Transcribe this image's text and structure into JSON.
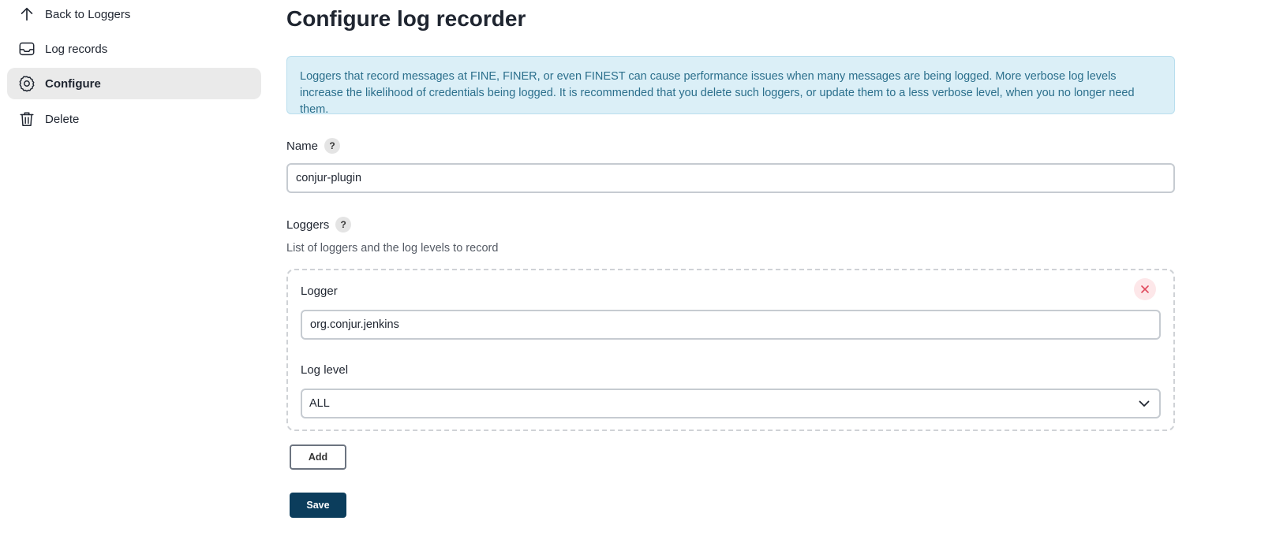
{
  "sidebar": {
    "items": [
      {
        "label": "Back to Loggers",
        "icon": "arrow-up-icon"
      },
      {
        "label": "Log records",
        "icon": "inbox-icon"
      },
      {
        "label": "Configure",
        "icon": "gear-icon",
        "active": true
      },
      {
        "label": "Delete",
        "icon": "trash-icon"
      }
    ]
  },
  "main": {
    "title": "Configure log recorder",
    "alert": "Loggers that record messages at FINE, FINER, or even FINEST can cause performance issues when many messages are being logged. More verbose log levels increase the likelihood of credentials being logged. It is recommended that you delete such loggers, or update them to a less verbose level, when you no longer need them.",
    "name_label": "Name",
    "help_glyph": "?",
    "name_value": "conjur-plugin",
    "loggers_label": "Loggers",
    "loggers_description": "List of loggers and the log levels to record",
    "logger_entry": {
      "logger_label": "Logger",
      "logger_value": "org.conjur.jenkins",
      "level_label": "Log level",
      "level_value": "ALL"
    },
    "add_label": "Add",
    "save_label": "Save"
  },
  "colors": {
    "active_bg": "#eaeaea",
    "alert_bg": "#dbeff7",
    "alert_text": "#2b6f8c",
    "save_bg": "#0b3d5c",
    "close_icon": "#e0495d"
  }
}
